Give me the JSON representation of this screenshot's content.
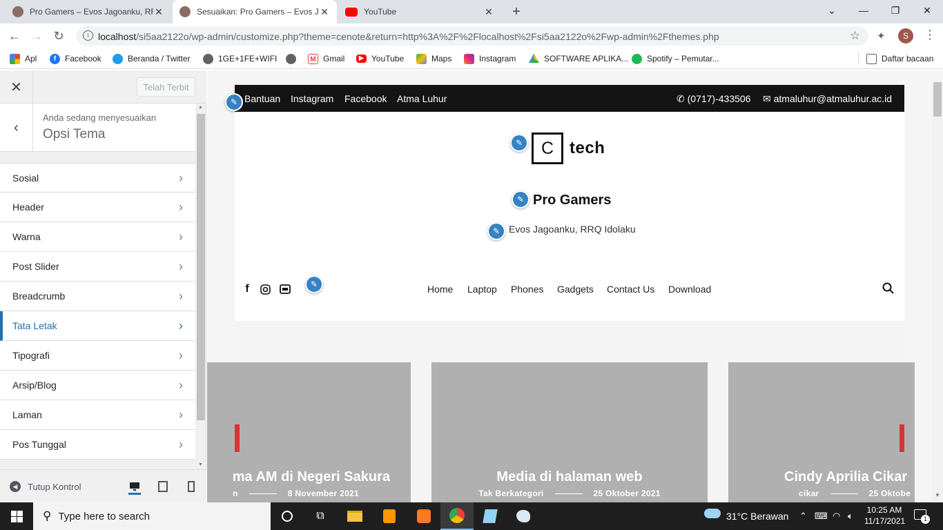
{
  "browser": {
    "tabs": [
      {
        "title": "Pro Gamers – Evos Jagoanku, RRQ",
        "active": false
      },
      {
        "title": "Sesuaikan: Pro Gamers – Evos Jag",
        "active": true
      },
      {
        "title": "YouTube",
        "active": false
      }
    ],
    "url_host": "localhost",
    "url_path": "/si5aa2122o/wp-admin/customize.php?theme=cenote&return=http%3A%2F%2Flocalhost%2Fsi5aa2122o%2Fwp-admin%2Fthemes.php",
    "profile_initial": "S",
    "bookmarks": [
      {
        "label": "Apl",
        "icon": "apps-grid-icon"
      },
      {
        "label": "Facebook",
        "icon": "facebook-icon"
      },
      {
        "label": "Beranda / Twitter",
        "icon": "twitter-icon"
      },
      {
        "label": "1GE+1FE+WIFI",
        "icon": "globe-icon"
      },
      {
        "label": "",
        "icon": "globe-icon"
      },
      {
        "label": "Gmail",
        "icon": "gmail-icon"
      },
      {
        "label": "YouTube",
        "icon": "youtube-icon"
      },
      {
        "label": "Maps",
        "icon": "maps-icon"
      },
      {
        "label": "Instagram",
        "icon": "instagram-icon"
      },
      {
        "label": "SOFTWARE APLIKA...",
        "icon": "google-drive-icon"
      },
      {
        "label": "Spotify – Pemutar...",
        "icon": "spotify-icon"
      }
    ],
    "reading_list": "Daftar bacaan"
  },
  "customizer": {
    "publish_label": "Telah Terbit",
    "section_sub": "Anda sedang menyesuaikan",
    "section_title": "Opsi Tema",
    "items": [
      {
        "label": "Sosial",
        "active": false
      },
      {
        "label": "Header",
        "active": false
      },
      {
        "label": "Warna",
        "active": false
      },
      {
        "label": "Post Slider",
        "active": false
      },
      {
        "label": "Breadcrumb",
        "active": false
      },
      {
        "label": "Tata Letak",
        "active": true
      },
      {
        "label": "Tipografi",
        "active": false
      },
      {
        "label": "Arsip/Blog",
        "active": false
      },
      {
        "label": "Laman",
        "active": false
      },
      {
        "label": "Pos Tunggal",
        "active": false
      }
    ],
    "collapse_label": "Tutup Kontrol",
    "accent_color": "#2271b1"
  },
  "site": {
    "topbar_links": [
      "Bantuan",
      "Instagram",
      "Facebook",
      "Atma Luhur"
    ],
    "phone": "(0717)-433506",
    "email": "atmaluhur@atmaluhur.ac.id",
    "logo_letter": "C",
    "logo_word": "tech",
    "title": "Pro Gamers",
    "tagline": "Evos Jagoanku, RRQ Idolaku",
    "menu": [
      "Home",
      "Laptop",
      "Phones",
      "Gadgets",
      "Contact Us",
      "Download"
    ],
    "cards": [
      {
        "title": "ma AM di Negeri Sakura",
        "category": "n",
        "date": "8 November 2021"
      },
      {
        "title": "Media di halaman web",
        "category": "Tak Berkategori",
        "date": "25 Oktober 2021"
      },
      {
        "title": "Cindy Aprilia Cikar",
        "category": "cikar",
        "date": "25 Oktobe"
      }
    ]
  },
  "taskbar": {
    "search_placeholder": "Type here to search",
    "weather": "31°C  Berawan",
    "time": "10:25 AM",
    "date": "11/17/2021",
    "notifications": "1"
  }
}
